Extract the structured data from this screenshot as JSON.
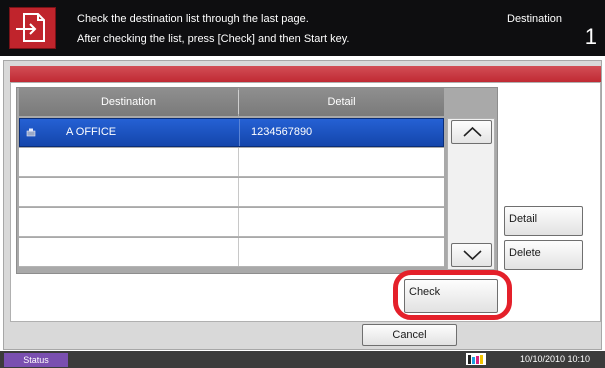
{
  "header": {
    "message_line1": "Check the destination list through the last page.",
    "message_line2": "After checking the list, press [Check] and then Start key.",
    "destination_label": "Destination",
    "destination_count": "1",
    "icon": "send-check-icon",
    "accent_color": "#c0242c"
  },
  "list": {
    "columns": [
      "Destination",
      "Detail"
    ],
    "rows": [
      {
        "name": "A OFFICE",
        "detail": "1234567890",
        "icon": "fax-icon",
        "selected": true
      },
      {
        "name": "",
        "detail": "",
        "selected": false
      },
      {
        "name": "",
        "detail": "",
        "selected": false
      },
      {
        "name": "",
        "detail": "",
        "selected": false
      },
      {
        "name": "",
        "detail": "",
        "selected": false
      }
    ],
    "selection_color": "#1e55c4"
  },
  "buttons": {
    "detail": "Detail",
    "delete": "Delete",
    "check": "Check",
    "cancel": "Cancel",
    "scroll_up_icon": "chevron-up-icon",
    "scroll_down_icon": "chevron-down-icon"
  },
  "status_bar": {
    "status_label": "Status",
    "datetime": "10/10/2010  10:10"
  }
}
